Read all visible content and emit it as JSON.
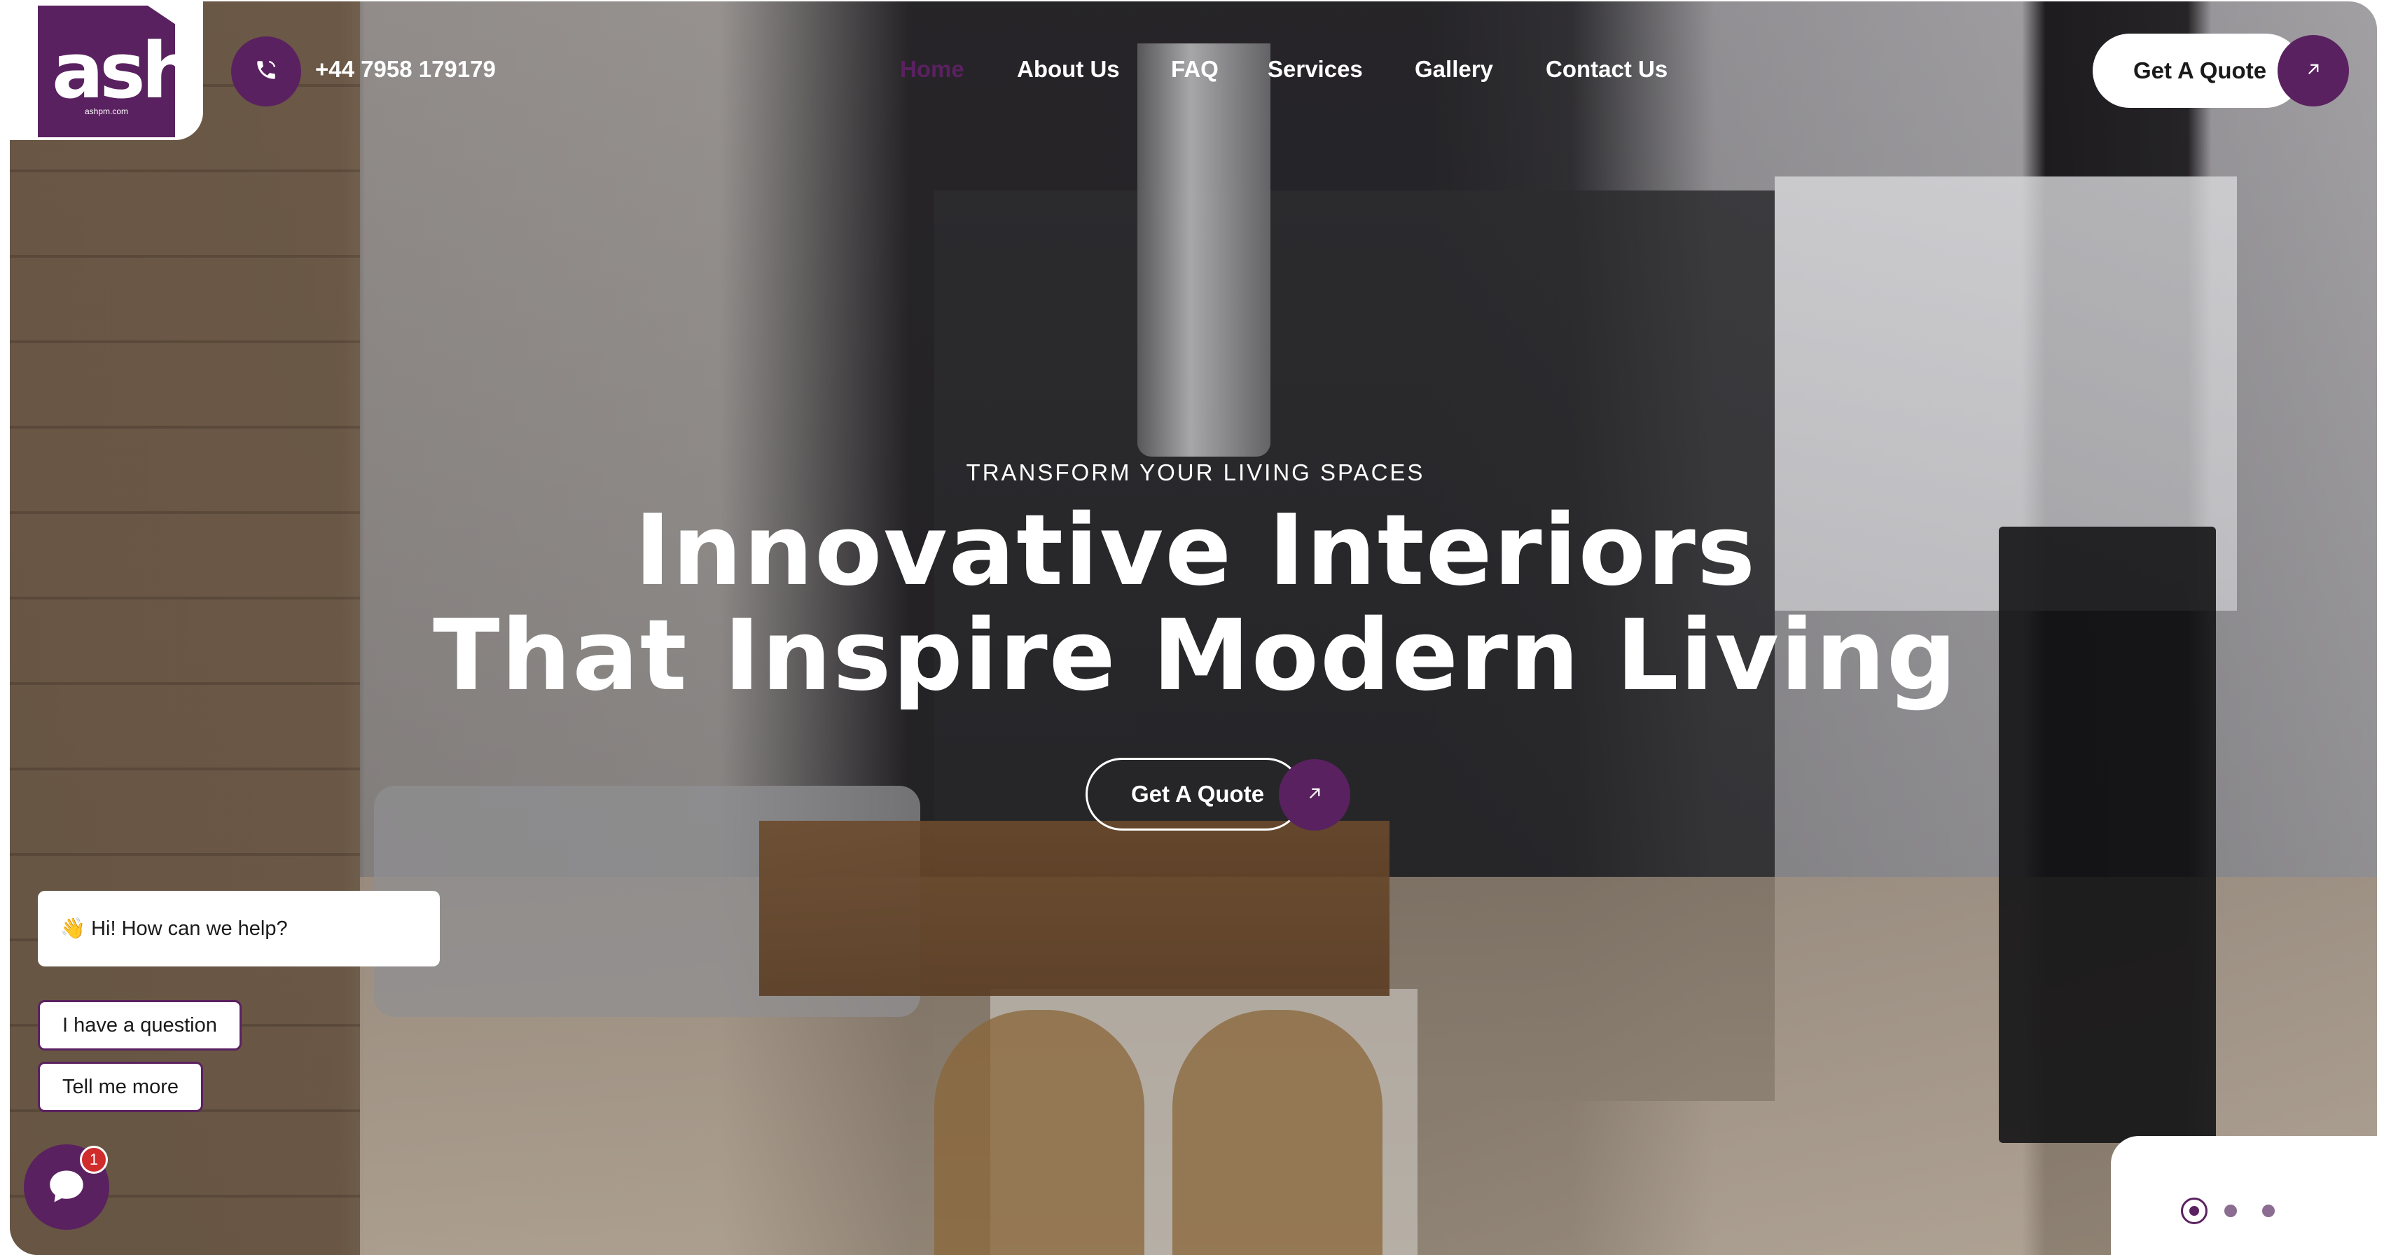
{
  "brand": {
    "logo_text": "ash",
    "logo_subtext": "ashpm.com"
  },
  "header": {
    "phone": "+44 7958 179179",
    "nav": [
      {
        "label": "Home"
      },
      {
        "label": "About Us"
      },
      {
        "label": "FAQ"
      },
      {
        "label": "Services"
      },
      {
        "label": "Gallery"
      },
      {
        "label": "Contact Us"
      }
    ],
    "quote_label": "Get A Quote"
  },
  "hero": {
    "eyebrow": "TRANSFORM YOUR LIVING SPACES",
    "headline_line1": "Innovative Interiors",
    "headline_line2": "That Inspire Modern Living",
    "cta_label": "Get A Quote"
  },
  "chat": {
    "greeting_emoji": "👋",
    "greeting": "Hi! How can we help?",
    "options": [
      "I have a question",
      "Tell me more"
    ],
    "badge_count": "1"
  },
  "slider": {
    "slide_count": 3,
    "active_index": 0
  },
  "colors": {
    "accent": "#5a2160",
    "badge": "#d12c2c"
  },
  "icons": {
    "phone": "phone-icon",
    "arrow": "arrow-up-right-icon",
    "chat": "chat-bubble-icon"
  }
}
